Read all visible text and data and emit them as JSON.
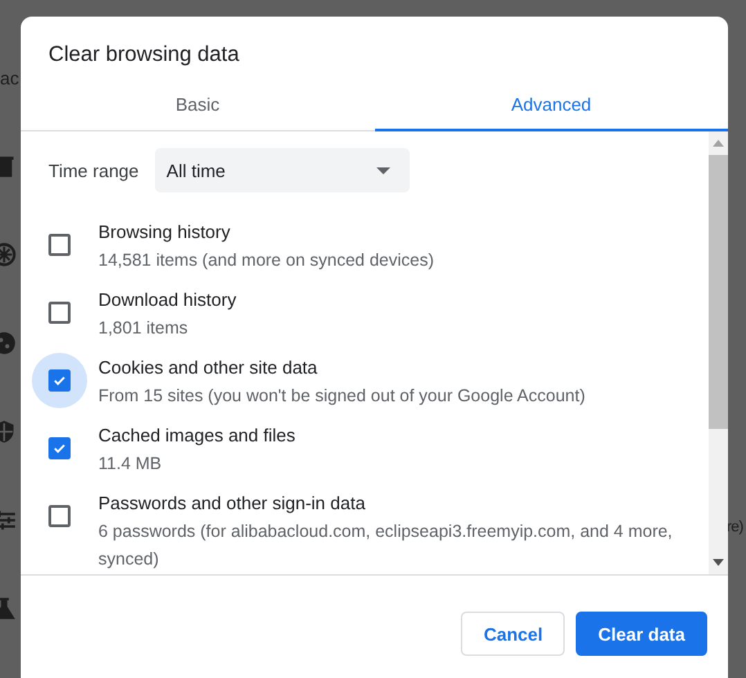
{
  "background": {
    "left_text": "ac",
    "right_text": "re)"
  },
  "dialog": {
    "title": "Clear browsing data",
    "tabs": [
      {
        "label": "Basic",
        "selected": false
      },
      {
        "label": "Advanced",
        "selected": true
      }
    ],
    "time_range": {
      "label": "Time range",
      "value": "All time"
    },
    "items": [
      {
        "title": "Browsing history",
        "detail": "14,581 items (and more on synced devices)",
        "checked": false,
        "focused": false
      },
      {
        "title": "Download history",
        "detail": "1,801 items",
        "checked": false,
        "focused": false
      },
      {
        "title": "Cookies and other site data",
        "detail": "From 15 sites (you won't be signed out of your Google Account)",
        "checked": true,
        "focused": true
      },
      {
        "title": "Cached images and files",
        "detail": "11.4 MB",
        "checked": true,
        "focused": false
      },
      {
        "title": "Passwords and other sign-in data",
        "detail": "6 passwords (for alibabacloud.com, eclipseapi3.freemyip.com, and 4 more, synced)",
        "checked": false,
        "focused": false
      }
    ],
    "buttons": [
      {
        "label": "Cancel",
        "kind": "secondary"
      },
      {
        "label": "Clear data",
        "kind": "primary"
      }
    ]
  }
}
